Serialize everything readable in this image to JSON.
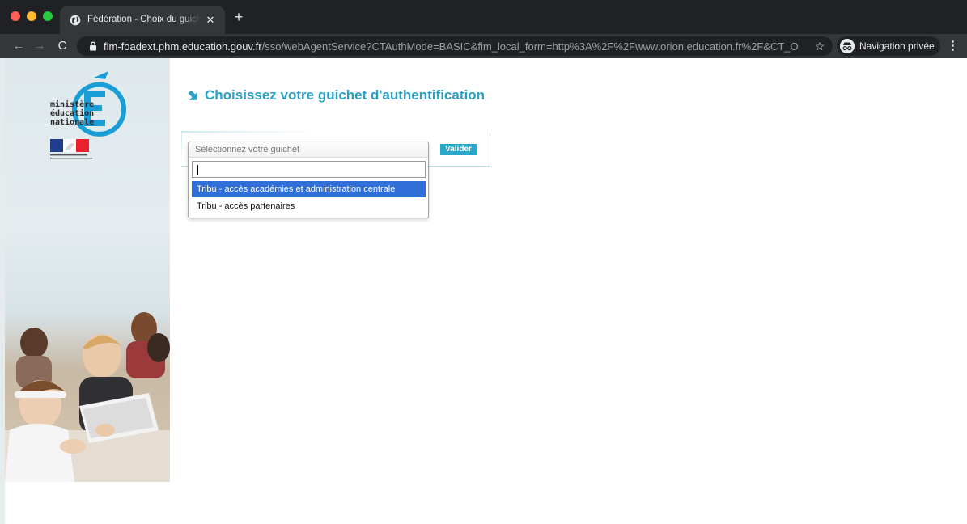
{
  "browser": {
    "tab_title": "Fédération - Choix du guichet d",
    "tab_close": "✕",
    "new_tab": "+",
    "url_host": "fim-foadext.phm.education.gouv.fr",
    "url_path": "/sso/webAgentService?CTAuthMode=BASIC&fim_local_form=http%3A%2F%2Fwww.orion.education.fr%2F&CT_ORIG_...",
    "star": "☆",
    "incognito_label": "Navigation privée",
    "menu": "⋮",
    "back": "←",
    "forward": "→",
    "reload": "C"
  },
  "sidebar": {
    "logo_lines": [
      "ministère",
      "éducation",
      "nationale"
    ]
  },
  "main": {
    "heading": "Choisissez votre guichet d'authentification",
    "select_placeholder": "Sélectionnez votre guichet",
    "search_value": "",
    "options": [
      "Tribu - accès académies et administration centrale",
      "Tribu - accès partenaires"
    ],
    "highlighted_option": 0,
    "submit_label": "Valider"
  },
  "colors": {
    "accent": "#2aa0c4",
    "highlight": "#2f6fd7",
    "chrome_dark": "#202124",
    "chrome_tab": "#35363a"
  }
}
